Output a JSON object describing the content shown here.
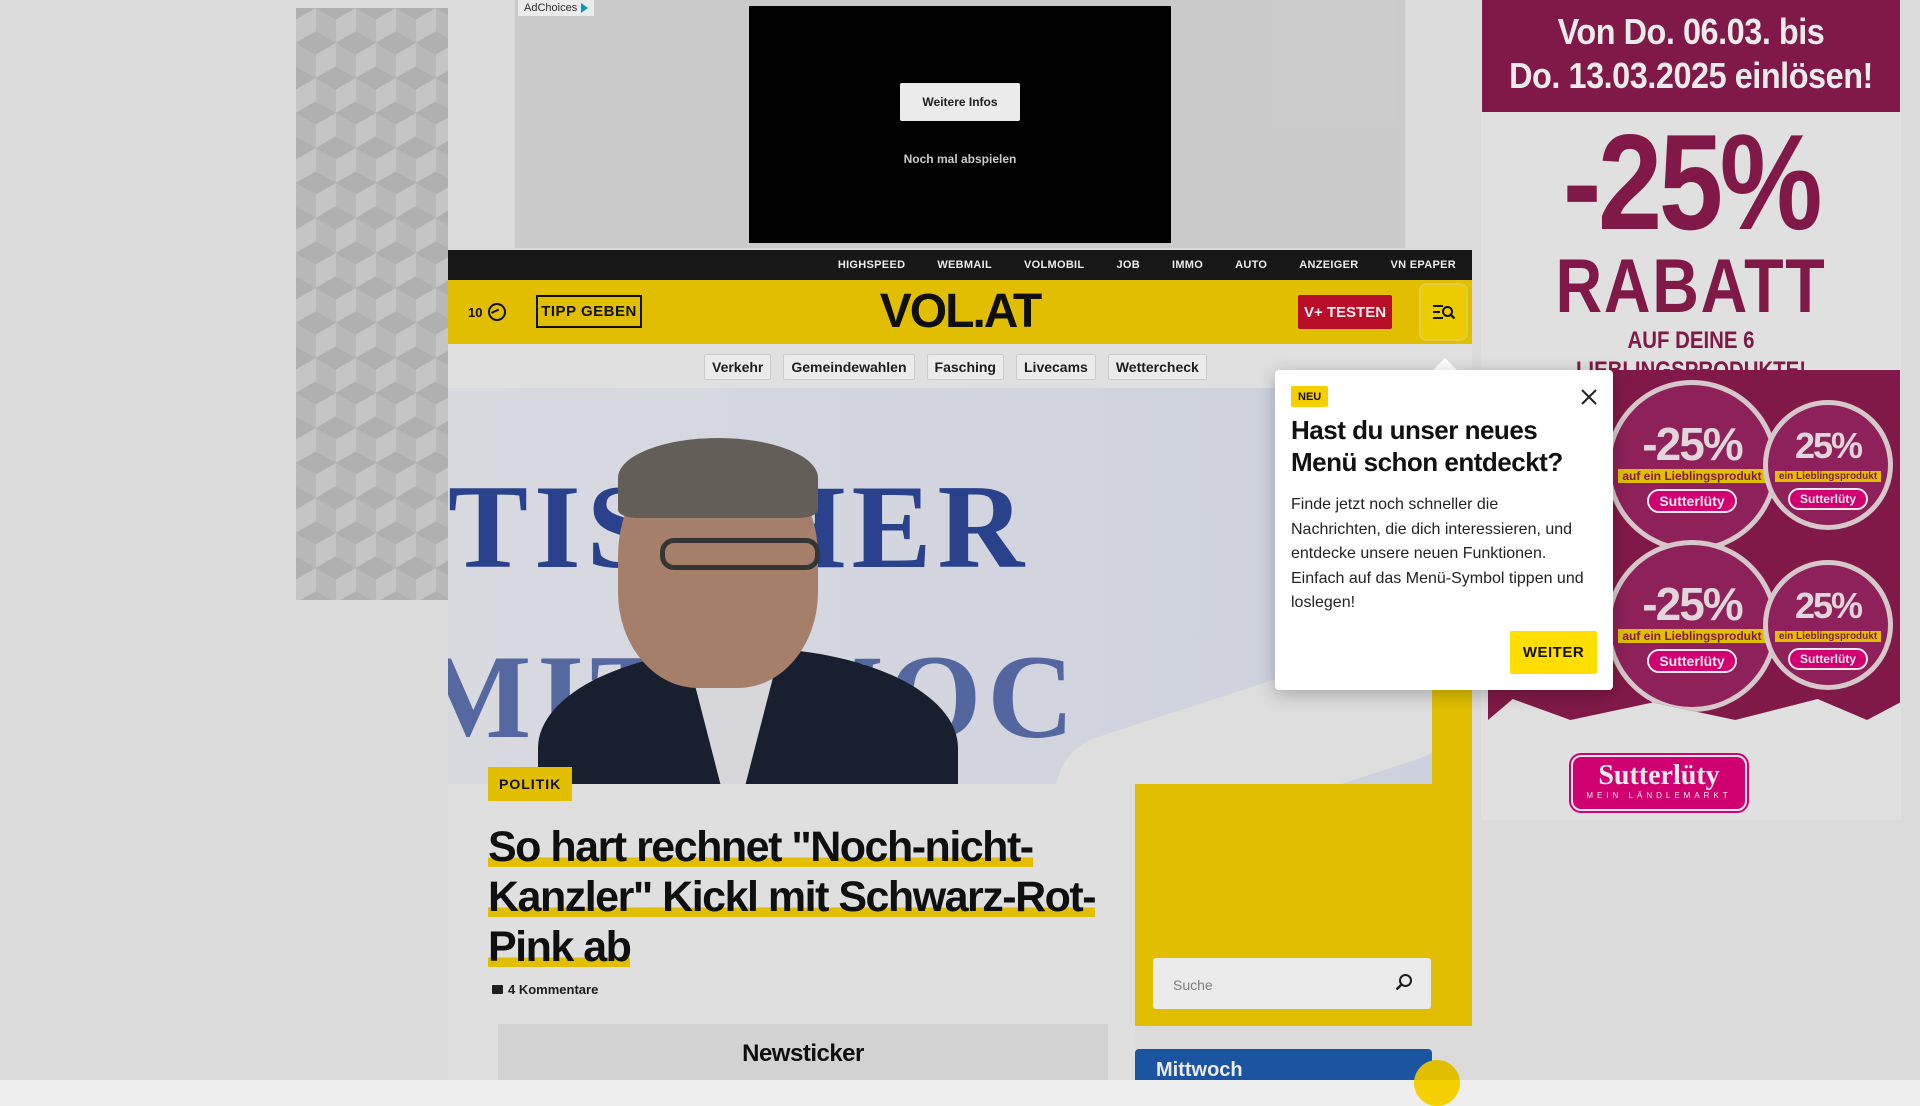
{
  "ad_top": {
    "adchoices_label": "AdChoices",
    "more_info_label": "Weitere Infos",
    "replay_label": "Noch mal abspielen"
  },
  "topbar": {
    "links": [
      "HIGHSPEED",
      "WEBMAIL",
      "VOLMOBIL",
      "JOB",
      "IMMO",
      "AUTO",
      "ANZEIGER",
      "VN EPAPER"
    ]
  },
  "header": {
    "weather_temp": "10",
    "tipp_label": "TIPP GEBEN",
    "logo": "VOL.AT",
    "vplus_label": "V+ TESTEN"
  },
  "subnav": {
    "items": [
      "Verkehr",
      "Gemeindewahlen",
      "Fasching",
      "Livecams",
      "Wettercheck"
    ]
  },
  "hero": {
    "wall_text_1": "TISCHER",
    "wall_text_2": "MITTWOC"
  },
  "article": {
    "category": "POLITIK",
    "headline_1": "So hart rechnet \"Noch-nicht-",
    "headline_2": "Kanzler\" Kickl mit Schwarz-Rot-",
    "headline_3": "Pink ab",
    "comments": "4 Kommentare",
    "newsticker": "Newsticker"
  },
  "sidebar": {
    "search_placeholder": "Suche",
    "weather_day": "Mittwoch"
  },
  "popup": {
    "badge": "NEU",
    "title": "Hast du unser neues Menü schon entdeckt?",
    "body": "Finde jetzt noch schneller die Nachrichten, die dich interessieren, und entdecke unsere neuen Funktionen. Einfach auf das Menü-Symbol tippen und loslegen!",
    "button": "WEITER"
  },
  "right_ad": {
    "dates_line_1": "Von Do. 06.03. bis",
    "dates_line_2": "Do. 13.03.2025 einlösen!",
    "percent": "-25%",
    "rabatt": "RABATT",
    "subline": "AUF DEINE 6 LIEBLINGSPRODUKTE!",
    "coupon_pct_large": "-25%",
    "coupon_pct_small": "25%",
    "coupon_label": "auf ein Lieblingsprodukt",
    "coupon_label_small": "ein Lieblingsprodukt",
    "coupon_brand": "Sutterlüty",
    "logo_name": "Sutterlüty",
    "logo_tagline": "MEIN LÄNDLEMARKT"
  },
  "colors": {
    "brand_yellow": "#f5d000",
    "vplus_red": "#c8102e",
    "ad_purple": "#8b1c4f",
    "ad_pink": "#e2007a",
    "weather_blue": "#1e5db0"
  }
}
